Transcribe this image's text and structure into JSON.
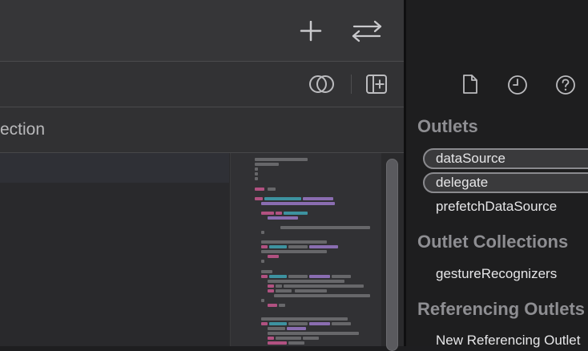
{
  "jumpbar": {
    "text": "ection"
  },
  "toolbar": {
    "add_icon": "plus-icon",
    "swap_icon": "arrows-left-right-icon",
    "compare_icon": "overlapping-circles-icon",
    "add_editor_icon": "add-editor-right-icon"
  },
  "inspector": {
    "tabs": [
      "file-icon",
      "history-clock-icon",
      "help-question-icon"
    ],
    "sections": {
      "outlets": {
        "title": "Outlets",
        "items": [
          {
            "label": "dataSource",
            "connected": true
          },
          {
            "label": "delegate",
            "connected": true
          },
          {
            "label": "prefetchDataSource",
            "connected": false
          }
        ]
      },
      "outlet_collections": {
        "title": "Outlet Collections",
        "items": [
          {
            "label": "gestureRecognizers",
            "connected": false
          }
        ]
      },
      "referencing_outlets": {
        "title": "Referencing Outlets",
        "items": [
          {
            "label": "New Referencing Outlet",
            "connected": false
          }
        ]
      }
    }
  },
  "colors": {
    "keyword": "#c8578f",
    "type": "#3fa3b4",
    "method": "#9a78c8",
    "plain": "#8c8c90"
  }
}
